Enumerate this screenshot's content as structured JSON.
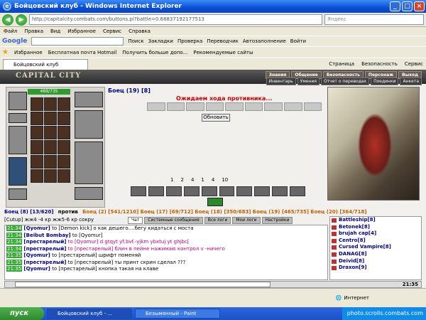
{
  "window": {
    "title": "Бойцовский клуб - Windows Internet Explorer"
  },
  "address": {
    "url": "http://capitalcity.combats.com/buttons.pl?battle=0.6883719217751​3",
    "search_placeholder": "Яндекс"
  },
  "menu": [
    "Файл",
    "Правка",
    "Вид",
    "Избранное",
    "Сервис",
    "Справка"
  ],
  "google": {
    "logo": "Google",
    "items": [
      "Поиск",
      "Закладки",
      "Проверка",
      "Переводчик",
      "Автозаполнение",
      "Войти"
    ]
  },
  "favorites": {
    "label": "Избранное",
    "items": [
      "Бесплатная почта Hotmail",
      "Получить больше допо...",
      "Рекомендуемые сайты"
    ]
  },
  "tab": {
    "title": "Бойцовский клуб",
    "tools": [
      "Страница",
      "Безопасность",
      "Сервис"
    ]
  },
  "game": {
    "logo": "CAPITAL CITY",
    "top_nav": [
      "Знания",
      "Общение",
      "Безопасность",
      "Персонаж",
      "Выход"
    ],
    "sub_nav": [
      "Инвентарь",
      "Умения",
      "Отчет о переводах",
      "Поединки",
      "Анкета"
    ],
    "hp": "469/735",
    "fighter": "Боец (19) [8]",
    "wait_text": "Ожидаем хода противника...",
    "refresh_label": "Обновить",
    "counts": [
      "1",
      "2",
      "4",
      "1",
      "4",
      "10"
    ],
    "vs": {
      "you": "Боец (8) [13/620]",
      "vs_label": "против",
      "enemies": [
        "Боец (2) [541/1210]",
        "Боец (17) [69/712]",
        "Боец (18) [350/683]",
        "Боец (19) [465/735]",
        "Боец (20) [364/718]"
      ]
    },
    "status": "[Cutup] жж4 -4 кр жж5-6 кр сокру",
    "chat_tabs": [
      "Чат",
      "Системные сообщения",
      "Все логи",
      "Мои логи",
      "Настройки"
    ],
    "chat": [
      {
        "time": "21:34",
        "nick": "[Qyomur]",
        "text": "to [Demon kick] о как дешего....бегу кидаться с моста",
        "pink": false
      },
      {
        "time": "21:34",
        "nick": "[Beibut Bombay]",
        "text": "to [Qyomur]",
        "pink": false
      },
      {
        "time": "21:34",
        "nick": "[престарелый]",
        "text": "to [Qyomur] d gtqyt yf;bvf.-yjkm ybxtuj yt ghjbc[",
        "pink": true
      },
      {
        "time": "21:34",
        "nick": "[престарелый]",
        "text": "to [престарелый] блин в пейне нажимаю контрол v -ничего",
        "pink": true
      },
      {
        "time": "21:35",
        "nick": "[Qyomur]",
        "text": "to [престарелый] шрифт поменяй",
        "pink": false
      },
      {
        "time": "21:35",
        "nick": "[престарелый]",
        "text": "to [престарелый] ты принт скрин сделал ???",
        "pink": false
      },
      {
        "time": "21:35",
        "nick": "[Qyomur]",
        "text": "to [престарелый] кнопка такая на клаве",
        "pink": false
      }
    ],
    "players": [
      "Battleship[8]",
      "Betonek[8]",
      "brujah cap[4]",
      "Centro[8]",
      "Cursed Vampire[8]",
      "DANAG[8]",
      "Deivid[8]",
      "Draxon[9]"
    ],
    "clock": "21:35"
  },
  "statusbar": {
    "zone": "Интернет"
  },
  "taskbar": {
    "start": "пуск",
    "tasks": [
      "Бойцовский клуб - ...",
      "Безымянный - Paint"
    ],
    "tray": "photo.scrolls.combats.com"
  }
}
